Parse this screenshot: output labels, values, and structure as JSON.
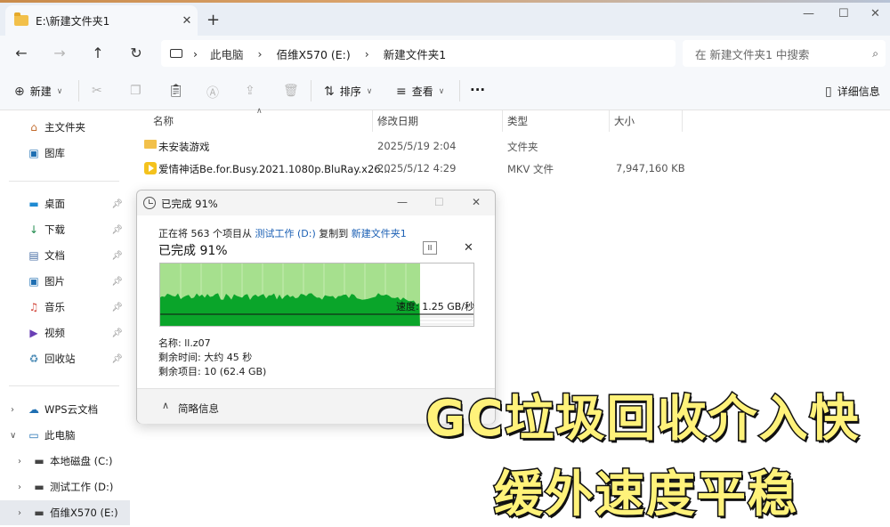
{
  "window": {
    "tab_title": "E:\\新建文件夹1",
    "new_tab": "+",
    "tab_close": "✕",
    "minimize": "—",
    "maximize": "☐",
    "close": "✕"
  },
  "address": {
    "crumbs": [
      "此电脑",
      "佰维X570 (E:)",
      "新建文件夹1"
    ],
    "search_placeholder": "在 新建文件夹1 中搜索"
  },
  "toolbar": {
    "new_label": "新建",
    "sort_label": "排序",
    "view_label": "查看",
    "more_label": "···",
    "details_label": "详细信息"
  },
  "sidebar": {
    "home": "主文件夹",
    "gallery": "图库",
    "quick": [
      {
        "label": "桌面",
        "icon": "desktop-icon"
      },
      {
        "label": "下载",
        "icon": "download-icon"
      },
      {
        "label": "文档",
        "icon": "document-icon"
      },
      {
        "label": "图片",
        "icon": "picture-icon"
      },
      {
        "label": "音乐",
        "icon": "music-icon"
      },
      {
        "label": "视频",
        "icon": "video-icon"
      },
      {
        "label": "回收站",
        "icon": "recycle-bin-icon"
      }
    ],
    "wps": "WPS云文档",
    "this_pc": "此电脑",
    "drives": [
      "本地磁盘 (C:)",
      "测试工作 (D:)",
      "佰维X570 (E:)"
    ]
  },
  "columns": {
    "name": "名称",
    "modified": "修改日期",
    "type": "类型",
    "size": "大小"
  },
  "files": [
    {
      "name": "未安装游戏",
      "modified": "2025/5/19 2:04",
      "type": "文件夹",
      "size": ""
    },
    {
      "name": "爱情神话Be.for.Busy.2021.1080p.BluRay.x26...",
      "modified": "2025/5/12 4:29",
      "type": "MKV 文件",
      "size": "7,947,160 KB"
    }
  ],
  "copy_dialog": {
    "title": "已完成 91%",
    "line_prefix": "正在将 563 个项目从",
    "source": "测试工作 (D:)",
    "line_mid": "复制到",
    "dest": "新建文件夹1",
    "big_status": "已完成 91%",
    "pause_glyph": "II",
    "cancel_glyph": "✕",
    "progress": 0.91,
    "speed_label": "速度: 1.25 GB/秒",
    "name_label": "名称: ll.z07",
    "time_label": "剩余时间: 大约 45 秒",
    "items_label": "剩余项目: 10 (62.4 GB)",
    "less_info": "简略信息",
    "chevron": "∧"
  },
  "overlay": {
    "line1": "GC垃圾回收介入快",
    "line2": "缓外速度平稳",
    "color": "#fff27a"
  }
}
